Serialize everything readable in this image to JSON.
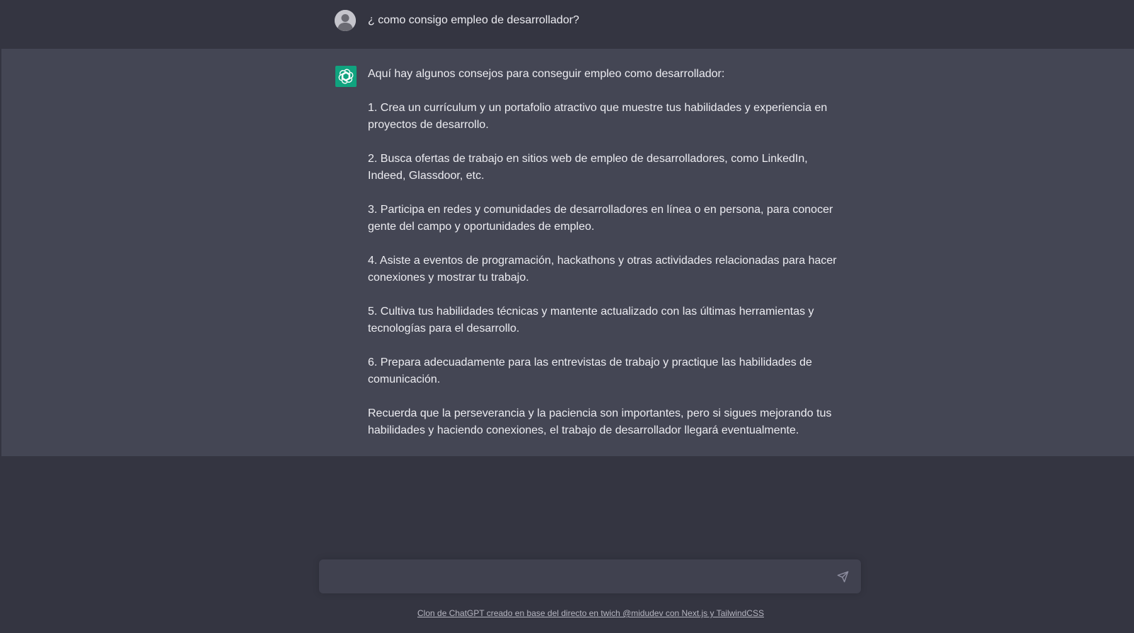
{
  "conversation": {
    "user_message": "¿ como consigo empleo de desarrollador?",
    "assistant_paragraphs": [
      "Aquí hay algunos consejos para conseguir empleo como desarrollador:",
      "1. Crea un currículum y un portafolio atractivo que muestre tus habilidades y experiencia en proyectos de desarrollo.",
      "2. Busca ofertas de trabajo en sitios web de empleo de desarrolladores, como LinkedIn, Indeed, Glassdoor, etc.",
      "3. Participa en redes y comunidades de desarrolladores en línea o en persona, para conocer gente del campo y oportunidades de empleo.",
      "4. Asiste a eventos de programación, hackathons y otras actividades relacionadas para hacer conexiones y mostrar tu trabajo.",
      "5. Cultiva tus habilidades técnicas y mantente actualizado con las últimas herramientas y tecnologías para el desarrollo.",
      "6. Prepara adecuadamente para las entrevistas de trabajo y practique las habilidades de comunicación.",
      "Recuerda que la perseverancia y la paciencia son importantes, pero si sigues mejorando tus habilidades y haciendo conexiones, el trabajo de desarrollador llegará eventualmente."
    ]
  },
  "input": {
    "value": "",
    "placeholder": ""
  },
  "footer": {
    "link_text": "Clon de ChatGPT creado en base del directo en twich @midudev con Next.js y TailwindCSS"
  },
  "icons": {
    "user_avatar": "user-avatar-icon",
    "bot_avatar": "openai-logo-icon",
    "send": "send-icon"
  },
  "colors": {
    "background": "#343541",
    "assistant_row": "#444654",
    "input": "#40414f",
    "bot_accent": "#10a37f"
  }
}
